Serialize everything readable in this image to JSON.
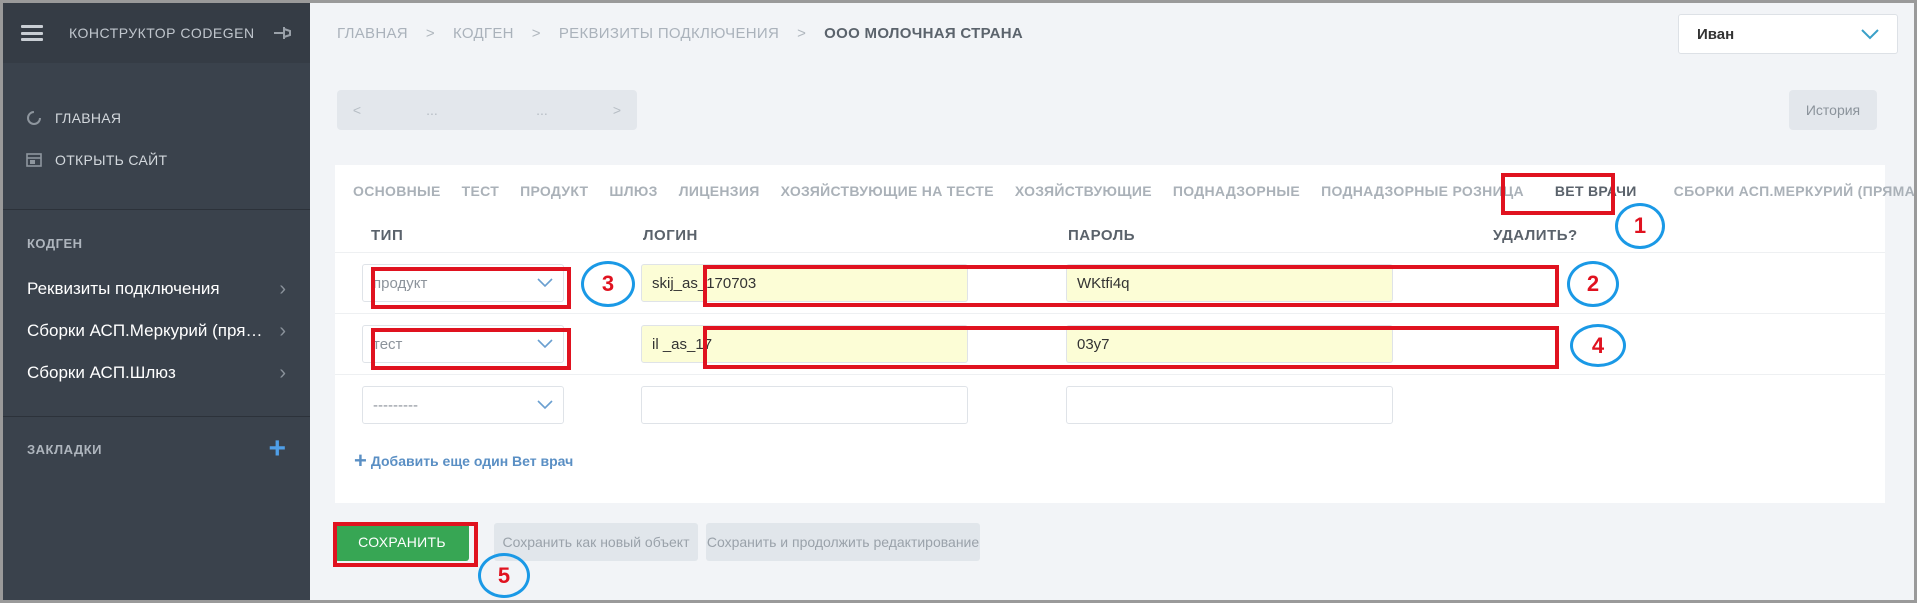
{
  "sidebar": {
    "title": "КОНСТРУКТОР CODEGEN",
    "links": [
      {
        "label": "ГЛАВНАЯ"
      },
      {
        "label": "ОТКРЫТЬ САЙТ"
      }
    ],
    "section_title": "КОДГЕН",
    "items": [
      {
        "label": "Реквизиты подключения"
      },
      {
        "label": "Сборки АСП.Меркурий (прямая)"
      },
      {
        "label": "Сборки АСП.Шлюз"
      }
    ],
    "bookmarks_label": "ЗАКЛАДКИ",
    "bookmarks_add": "+"
  },
  "breadcrumb": {
    "items": [
      "ГЛАВНАЯ",
      "КОДГЕН",
      "РЕКВИЗИТЫ ПОДКЛЮЧЕНИЯ"
    ],
    "current": "ООО МОЛОЧНАЯ СТРАНА",
    "separator": ">"
  },
  "user": {
    "name": "Иван"
  },
  "pager": {
    "prev": "<",
    "left": "...",
    "right": "...",
    "next": ">"
  },
  "history_label": "История",
  "tabs": [
    "ОСНОВНЫЕ",
    "ТЕСТ",
    "ПРОДУКТ",
    "ШЛЮЗ",
    "ЛИЦЕНЗИЯ",
    "ХОЗЯЙСТВУЮЩИЕ НА ТЕСТЕ",
    "ХОЗЯЙСТВУЮЩИЕ",
    "ПОДНАДЗОРНЫЕ",
    "ПОДНАДЗОРНЫЕ РОЗНИЦА",
    "ВЕТ ВРАЧИ",
    "СБОРКИ АСП.МЕРКУРИЙ (ПРЯМАЯ)"
  ],
  "active_tab": "ВЕТ ВРАЧИ",
  "table": {
    "headers": {
      "type": "ТИП",
      "login": "ЛОГИН",
      "password": "ПАРОЛЬ",
      "delete": "УДАЛИТЬ?"
    },
    "rows": [
      {
        "type": "продукт",
        "login": "skij_as_170703",
        "password": "WKtfi4q"
      },
      {
        "type": "тест",
        "login": "il _as_17",
        "password": "03y7"
      },
      {
        "type": "---------",
        "login": "",
        "password": ""
      }
    ]
  },
  "add_link": "Добавить еще один Вет врач",
  "buttons": {
    "save": "СОХРАНИТЬ",
    "save_new": "Сохранить как новый объект",
    "save_continue": "Сохранить и продолжить редактирование"
  },
  "annotations": [
    "1",
    "2",
    "3",
    "4",
    "5"
  ],
  "colors": {
    "accent_green": "#37a654",
    "annotation_red": "#e0121f",
    "annotation_blue": "#1a99e6"
  }
}
